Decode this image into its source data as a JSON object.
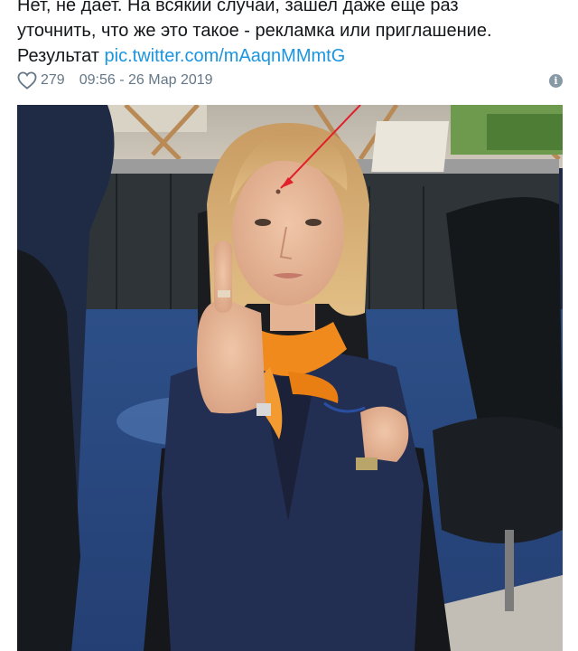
{
  "tweet": {
    "lines": [
      "Нет, не дает. На всякий случай, зашел даже еще раз",
      "уточнить, что же это такое - рекламка или приглашение."
    ],
    "result_label": "Результат",
    "link_text": "pic.twitter.com/mAaqnMMmtG"
  },
  "meta": {
    "likes": "279",
    "timestamp": "09:56 - 26 Мар 2019",
    "heart_icon": "heart-outline-icon",
    "info_icon": "info-icon"
  },
  "photo": {
    "description_icon": "tweet-photo",
    "accent_color": "#f08a1c",
    "annotation_color": "#e0202a"
  }
}
